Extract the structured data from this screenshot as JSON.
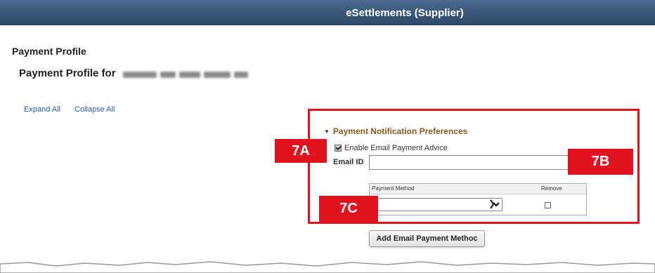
{
  "banner": {
    "title": "eSettlements (Supplier)"
  },
  "page": {
    "heading": "Payment Profile",
    "profile_for_label": "Payment Profile for"
  },
  "links": {
    "expand_all": "Expand All",
    "collapse_all": "Collapse All"
  },
  "section": {
    "title": "Payment Notification Preferences",
    "enable_label": "Enable Email Payment Advice",
    "enable_checked": true,
    "email_label": "Email ID",
    "email_value": "",
    "grid": {
      "col_payment_method": "Payment Method",
      "col_remove": "Remove",
      "payment_method_value": "",
      "remove_checked": false
    },
    "add_button_label": "Add Email Payment Methoc"
  },
  "callouts": {
    "a": "7A",
    "b": "7B",
    "c": "7C"
  },
  "colors": {
    "banner": "#2c4866",
    "callout_red": "#e0131f",
    "link": "#2f5bb3",
    "section_title": "#8a5a20"
  },
  "icons": {
    "collapse": "triangle-down-icon",
    "dropdown": "chevron-down-icon"
  }
}
